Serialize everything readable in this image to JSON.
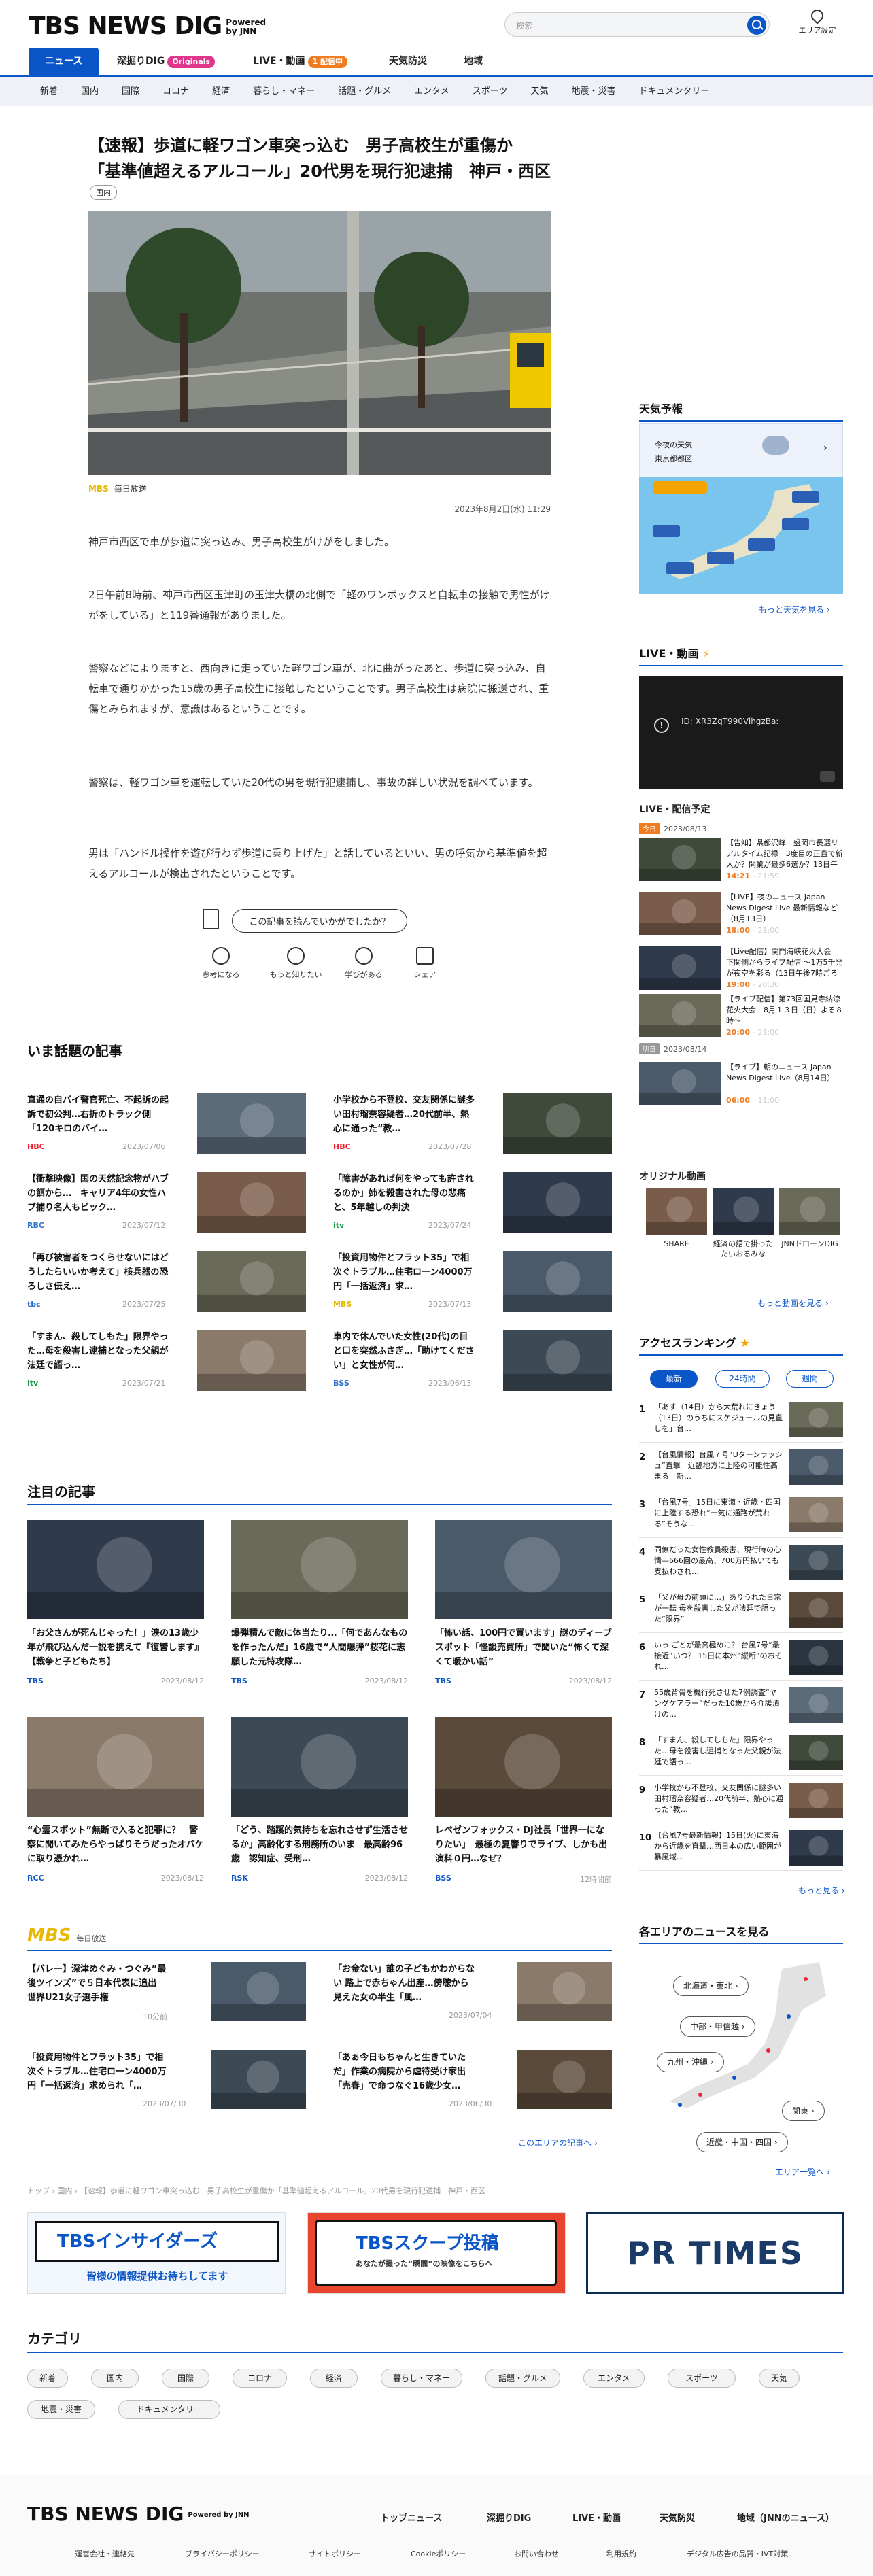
{
  "header": {
    "logo": "TBS NEWS DIG",
    "powered": "Powered",
    "by_jnn": "by JNN",
    "search_placeholder": "検索",
    "area_label": "エリア設定"
  },
  "nav": {
    "news": "ニュース",
    "originals": "深掘りDIG",
    "originals_badge": "Originals",
    "live": "LIVE・動画",
    "live_badge": "1 配信中",
    "weather": "天気防災",
    "area": "地域"
  },
  "categories": [
    "新着",
    "国内",
    "国際",
    "コロナ",
    "経済",
    "暮らし・マネー",
    "話題・グルメ",
    "エンタメ",
    "スポーツ",
    "天気",
    "地震・災害",
    "ドキュメンタリー"
  ],
  "article": {
    "headline1": "【速報】歩道に軽ワゴン車突っ込む　男子高校生が重傷か",
    "headline2": "「基準値超えるアルコール」20代男を現行犯逮捕　神戸・西区",
    "tag": "国内",
    "source_logo": "MBS",
    "source": "毎日放送",
    "date": "2023年8月2日(水) 11:29",
    "p1": "神戸市西区で車が歩道に突っ込み、男子高校生がけがをしました。",
    "p2": "2日午前8時前、神戸市西区玉津町の玉津大橋の北側で「軽のワンボックスと自転車の接触で男性がけがをしている」と119番通報がありました。",
    "p3": "警察などによりますと、西向きに走っていた軽ワゴン車が、北に曲がったあと、歩道に突っ込み、自転車で通りかかった15歳の男子高校生に接触したということです。男子高校生は病院に搬送され、重傷とみられますが、意識はあるということです。",
    "p4": "警察は、軽ワゴン車を運転していた20代の男を現行犯逮捕し、事故の詳しい状況を調べています。",
    "p5": "男は「ハンドル操作を遊び行わず歩道に乗り上げた」と話しているといい、男の呼気から基準値を超えるアルコールが検出されたということです。",
    "rating_q": "この記事を読んでいかがでしたか？",
    "reactions": [
      "参考になる",
      "もっと知りたい",
      "学びがある",
      "シェア"
    ]
  },
  "trending": {
    "title": "いま話題の記事",
    "items": [
      {
        "t": "直通の自バイ警官死亡、不起訴の起訴で初公判…右折のトラック側「120キロのバイ…",
        "src": "HBC",
        "d": "2023/07/06"
      },
      {
        "t": "小学校から不登校、交友関係に謎多い田村瑠奈容疑者…20代前半、熱心に通った“教…",
        "src": "HBC",
        "d": "2023/07/28"
      },
      {
        "t": "【衝撃映像】国の天然記念物がハブの餌から…　キャリア4年の女性ハブ捕り名人もビック…",
        "src": "RBC",
        "d": "2023/07/12"
      },
      {
        "t": "「障害があれば何をやっても許されるのか」姉を殺害された母の悲痛と、5年越しの判決",
        "src": "itv",
        "d": "2023/07/24"
      },
      {
        "t": "「再び被害者をつくらせないにはどうしたらいいか考えて」核兵器の恐ろしさ伝え…",
        "src": "tbc",
        "d": "2023/07/25"
      },
      {
        "t": "「投資用物件とフラット35」で相次ぐトラブル…住宅ローン4000万円「一括返済」求…",
        "src": "MBS",
        "d": "2023/07/13"
      },
      {
        "t": "「すまん、殺してしもた」限界やった…母を殺害し逮捕となった父親が法廷で語っ…",
        "src": "itv",
        "d": "2023/07/21"
      },
      {
        "t": "車内で休んでいた女性(20代)の目と口を突然ふさぎ…「助けてください」と女性が何…",
        "src": "BSS",
        "d": "2023/06/13"
      }
    ]
  },
  "featured": {
    "title": "注目の記事",
    "items": [
      {
        "t": "「お父さんが死んじゃった！」涙の13歳少年が飛び込んだ一説を携えて『復讐します』【戦争と子どもたち】",
        "src": "TBS",
        "d": "2023/08/12"
      },
      {
        "t": "爆弾積んで敵に体当たり…「何であんなものを作ったんだ」16歳で“人間爆弾”桜花に志願した元特攻隊…",
        "src": "TBS",
        "d": "2023/08/12"
      },
      {
        "t": "「怖い話、100円で買います」謎のディープスポット「怪談売買所」で聞いた“怖くて深くて暖かい話”",
        "src": "TBS",
        "d": "2023/08/12"
      },
      {
        "t": "“心霊スポット”無断で入ると犯罪に？　警察に聞いてみたらやっぱりそうだったオバケに取り憑かれ…",
        "src": "RCC",
        "d": "2023/08/12"
      },
      {
        "t": "「どう、踏蹊的気持ちを忘れさせず生活させるか」高齢化する刑務所のいま　最高齢96歳　認知症、受刑…",
        "src": "RSK",
        "d": "2023/08/12"
      },
      {
        "t": "レペゼンフォックス・DJ社長「世界一になりたい」　最極の夏響りでライブ、しかも出演料０円…なぜ？",
        "src": "BSS",
        "d": "12時間前"
      }
    ]
  },
  "mbs": {
    "logo": "MBS",
    "label": "毎日放送",
    "items": [
      {
        "t": "【バレー】深津めぐみ・つぐみ”最後ツインズ”で５日本代表に追出　世界U21女子選手権",
        "d": "10分前"
      },
      {
        "t": "「お金ない」誰の子どもかわからない 路上で赤ちゃん出産…傍聴から見えた女の半生「風…",
        "d": "2023/07/04"
      },
      {
        "t": "「投資用物件とフラット35」で相次ぐトラブル…住宅ローン4000万円「一括返済」求められ「…",
        "d": "2023/07/30"
      },
      {
        "t": "「あぁ今日もちゃんと生きていただ」作業の病院から虐待受け家出「売春」で命つなぐ16歳少女…",
        "d": "2023/06/30"
      }
    ],
    "more": "このエリアの記事へ"
  },
  "sidebar": {
    "weather_title": "天気予報",
    "weather_today": "今夜の天気",
    "weather_loc": "東京都都区",
    "weather_more": "もっと天気を見る",
    "live_title": "LIVE・動画",
    "video_id": "XR3ZqT990VihgzBa:",
    "video_label": "ID:",
    "sched_title": "LIVE・配信予定",
    "day1": "今日",
    "day1d": "2023/08/13",
    "day2": "明日",
    "day2d": "2023/08/14",
    "sched": [
      {
        "t": "【告知】県都沢峰　盛岡市長選リアルタイム記禄　3度目の正直で新人か？開業が最多6選か？13日午後8時ごろ～",
        "tm": "14:21",
        "tm2": "- 21:59"
      },
      {
        "t": "【LIVE】夜のニュース Japan News Digest Live 最新情報など（8月13日）",
        "tm": "18:00",
        "tm2": "- 21:00"
      },
      {
        "t": "【Live配信】関門海峡花火大会　下関側からライブ配信 ～1万5千発が夜空を彩る（13日午後7時ごろ配信開始）",
        "tm": "19:00",
        "tm2": "- 20:30"
      },
      {
        "t": "【ライブ配信】第73回国見寺納涼花火大会　8月１３日（日）よる８時～",
        "tm": "20:00",
        "tm2": "- 21:00"
      },
      {
        "t": "【ライブ】朝のニュース Japan News Digest Live（8月14日）",
        "tm": "06:00",
        "tm2": "- 11:00"
      }
    ],
    "orig_title": "オリジナル動画",
    "orig": [
      "SHARE",
      "経済の語で掛ったたいおるみな",
      "JNNドローンDIG"
    ],
    "orig_more": "もっと動画を見る",
    "rank_title": "アクセスランキング",
    "rank_tabs": [
      "最新",
      "24時間",
      "週間"
    ],
    "ranks": [
      "「あす（14日）から大荒れにきょう（13日）のうちにスケジュールの見直しを」台…",
      "【台風情報】台風７号“Uターンラッシュ”直撃　近畿地方に上陸の可能性高まる　新…",
      "「台風7号」15日に東海・近畿・四国に上陸する恐れ“一気に通路が荒れる”そうな…",
      "同僚だった女性教員殺害、現行時の心情—666回の最高、700万円払いても支払わされ…",
      "「父が母の前頭に…」ありうれた日常が一転 母を殺害した父が法廷で語った“限界”",
      "いっ ごとが最高極めに？ 台風7号“最接近”いつ？ 15日に本州“縦断”のおそれ…",
      "55歳背骨を機行死させた7例調査“ヤングケアラー”だった10歳から介護漬けの…",
      "「すまん、殺してしもた」限界やった…母を殺害し逮捕となった父親が法廷で語っ…",
      "小学校から不登校、交友関係に謎多い田村瑠奈容疑者…20代前半、熱心に通った“教…",
      "【台風7号最新情報】15日(火)に東海から近畿を直撃…西日本の広い範囲が暴風域…"
    ],
    "rank_more": "もっと見る",
    "area_title": "各エリアのニュースを見る",
    "areas": [
      "北海道・東北",
      "中部・甲信越",
      "九州・沖縄",
      "関東",
      "近畿・中国・四国"
    ],
    "area_more": "エリア一覧へ"
  },
  "crumb": "トップ › 国内 › 【速報】歩道に軽ワゴン車突っ込む　男子高校生が重傷か「基準値超えるアルコール」20代男を現行犯逮捕　神戸・西区",
  "banners": {
    "insiders": "TBSインサイダーズ",
    "insiders_sub": "皆様の情報提供お待ちしてます",
    "scoop": "TBSスクープ投稿",
    "scoop_sub": "あなたが撮った“瞬間”の映像をこちらへ",
    "prtimes": "PR TIMES"
  },
  "category_section": {
    "title": "カテゴリ",
    "items": [
      "新着",
      "国内",
      "国際",
      "コロナ",
      "経済",
      "暮らし・マネー",
      "話題・グルメ",
      "エンタメ",
      "スポーツ",
      "天気",
      "地震・災害",
      "ドキュメンタリー"
    ]
  },
  "footer": {
    "logo": "TBS NEWS DIG",
    "nav": [
      "トップニュース",
      "深掘りDIG",
      "LIVE・動画",
      "天気防災",
      "地域（JNNのニュース）"
    ],
    "links": [
      "運営会社・連絡先",
      "プライバシーポリシー",
      "サイトポリシー",
      "Cookieポリシー",
      "お問い合わせ",
      "利用規約",
      "デジタル広告の品質・IVT対策"
    ]
  },
  "colors": {
    "accent": "#0a55c8",
    "live": "#f07c22",
    "originals": "#e0368c"
  }
}
